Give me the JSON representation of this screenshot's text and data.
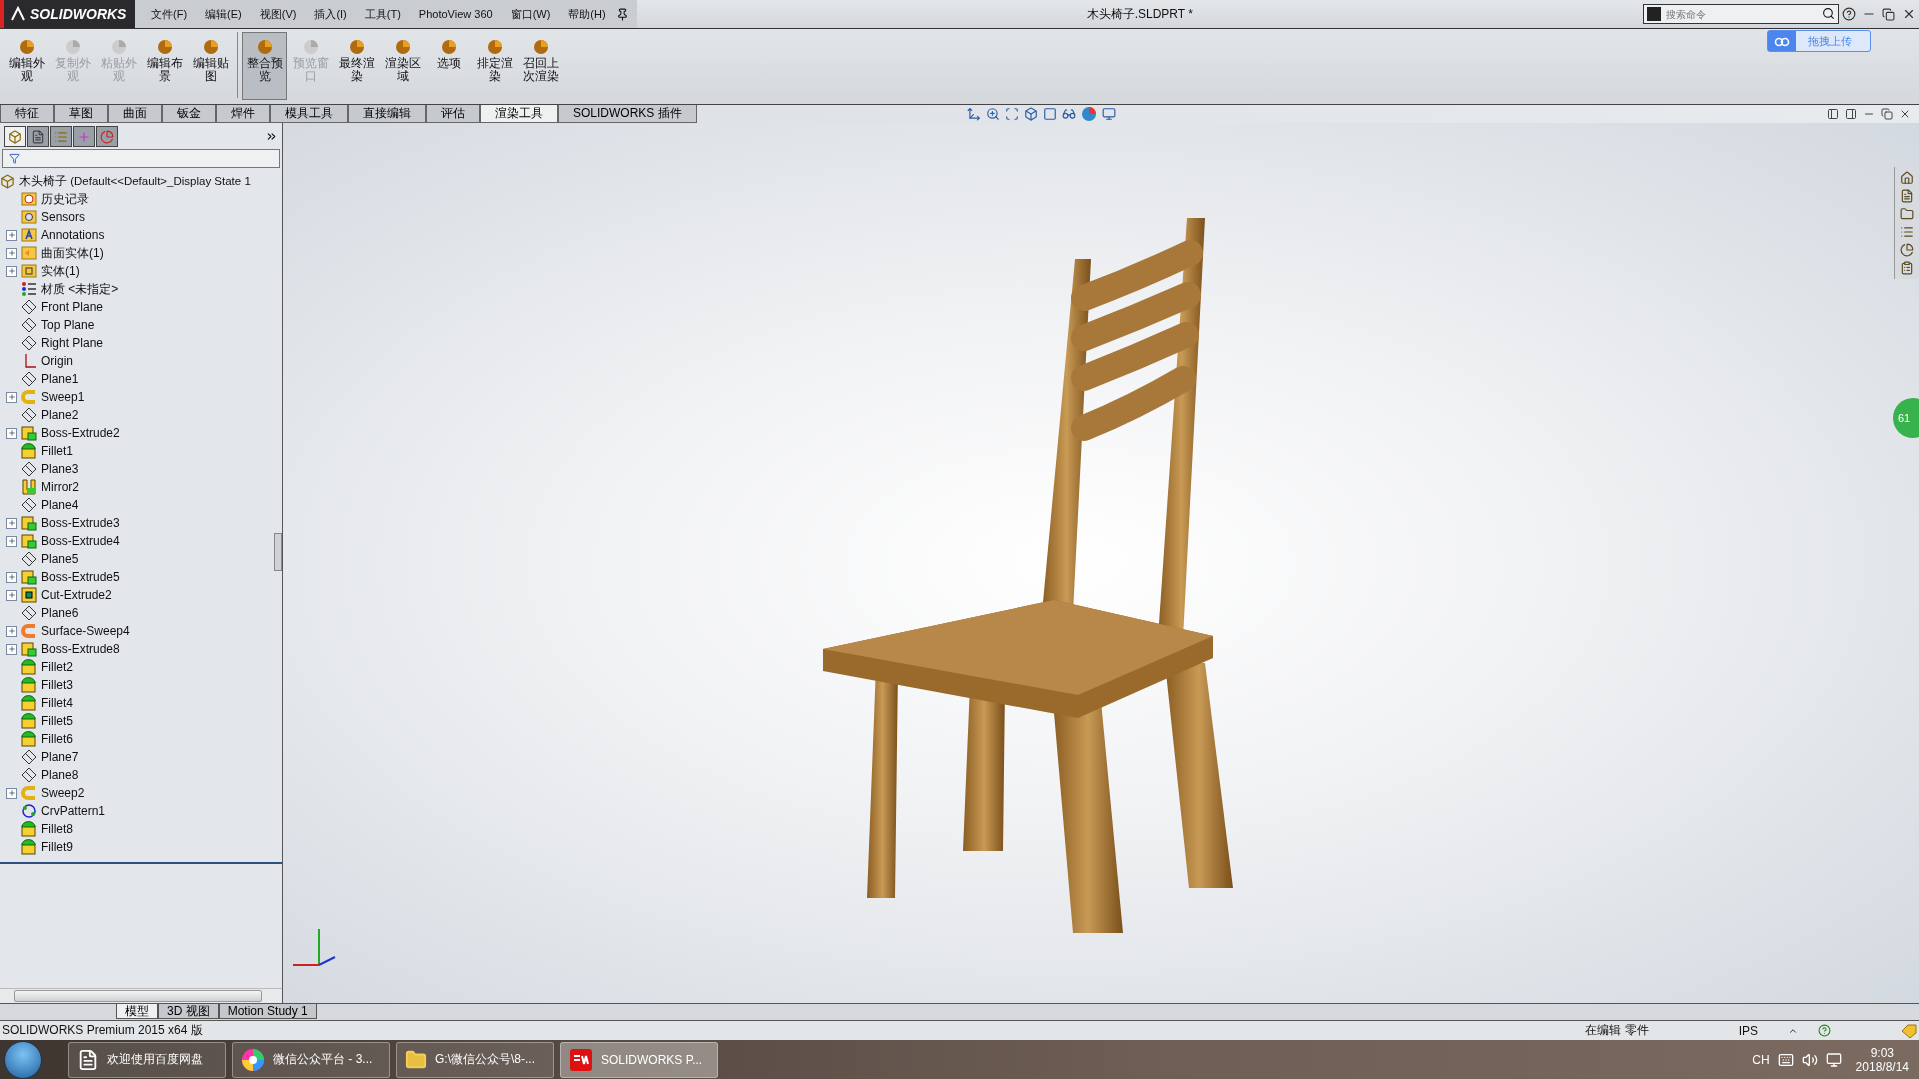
{
  "title_bar": {
    "logo": "SOLIDWORKS",
    "menus": [
      "文件(F)",
      "编辑(E)",
      "视图(V)",
      "插入(I)",
      "工具(T)",
      "PhotoView 360",
      "窗口(W)",
      "帮助(H)"
    ],
    "document_title": "木头椅子.SLDPRT *",
    "search": {
      "placeholder": "搜索命令"
    },
    "upload_button": "拖拽上传"
  },
  "ribbon": [
    {
      "label": "编辑外观",
      "disabled": false,
      "selected": false
    },
    {
      "label": "复制外观",
      "disabled": true,
      "selected": false
    },
    {
      "label": "粘贴外观",
      "disabled": true,
      "selected": false
    },
    {
      "label": "编辑布景",
      "disabled": false,
      "selected": false
    },
    {
      "label": "编辑贴图",
      "disabled": false,
      "selected": false
    },
    {
      "label": "整合预览",
      "disabled": false,
      "selected": true
    },
    {
      "label": "预览窗口",
      "disabled": true,
      "selected": false
    },
    {
      "label": "最终渲染",
      "disabled": false,
      "selected": false
    },
    {
      "label": "渲染区域",
      "disabled": false,
      "selected": false
    },
    {
      "label": "选项",
      "disabled": false,
      "selected": false
    },
    {
      "label": "排定渲染",
      "disabled": false,
      "selected": false
    },
    {
      "label": "召回上次渲染",
      "disabled": false,
      "selected": false
    }
  ],
  "command_tabs": [
    {
      "label": "特征",
      "selected": false
    },
    {
      "label": "草图",
      "selected": false
    },
    {
      "label": "曲面",
      "selected": false
    },
    {
      "label": "钣金",
      "selected": false
    },
    {
      "label": "焊件",
      "selected": false
    },
    {
      "label": "模具工具",
      "selected": false
    },
    {
      "label": "直接编辑",
      "selected": false
    },
    {
      "label": "评估",
      "selected": false
    },
    {
      "label": "渲染工具",
      "selected": true
    },
    {
      "label": "SOLIDWORKS 插件",
      "selected": false
    }
  ],
  "feature_tree": {
    "panel_tabs": [
      {
        "kind": "tree",
        "selected": true
      },
      {
        "kind": "property",
        "selected": false
      },
      {
        "kind": "config",
        "selected": false
      },
      {
        "kind": "target",
        "selected": false
      },
      {
        "kind": "display",
        "selected": false
      }
    ],
    "root": "木头椅子  (Default<<Default>_Display State 1",
    "items": [
      {
        "label": "历史记录",
        "kind": "history"
      },
      {
        "label": "Sensors",
        "kind": "sensor"
      },
      {
        "label": "Annotations",
        "kind": "annotation",
        "expanded": false
      },
      {
        "label": "曲面实体(1)",
        "kind": "surface-folder",
        "expanded": false
      },
      {
        "label": "实体(1)",
        "kind": "solid-folder",
        "expanded": false
      },
      {
        "label": "材质 <未指定>",
        "kind": "material"
      },
      {
        "label": "Front Plane",
        "kind": "plane"
      },
      {
        "label": "Top Plane",
        "kind": "plane"
      },
      {
        "label": "Right Plane",
        "kind": "plane"
      },
      {
        "label": "Origin",
        "kind": "origin"
      },
      {
        "label": "Plane1",
        "kind": "plane"
      },
      {
        "label": "Sweep1",
        "kind": "sweep",
        "expanded": false
      },
      {
        "label": "Plane2",
        "kind": "plane"
      },
      {
        "label": "Boss-Extrude2",
        "kind": "extrude",
        "expanded": false
      },
      {
        "label": "Fillet1",
        "kind": "fillet"
      },
      {
        "label": "Plane3",
        "kind": "plane"
      },
      {
        "label": "Mirror2",
        "kind": "mirror"
      },
      {
        "label": "Plane4",
        "kind": "plane"
      },
      {
        "label": "Boss-Extrude3",
        "kind": "extrude",
        "expanded": false
      },
      {
        "label": "Boss-Extrude4",
        "kind": "extrude",
        "expanded": false
      },
      {
        "label": "Plane5",
        "kind": "plane"
      },
      {
        "label": "Boss-Extrude5",
        "kind": "extrude",
        "expanded": false
      },
      {
        "label": "Cut-Extrude2",
        "kind": "cut",
        "expanded": false
      },
      {
        "label": "Plane6",
        "kind": "plane"
      },
      {
        "label": "Surface-Sweep4",
        "kind": "surface-sweep",
        "expanded": false
      },
      {
        "label": "Boss-Extrude8",
        "kind": "extrude",
        "expanded": false
      },
      {
        "label": "Fillet2",
        "kind": "fillet"
      },
      {
        "label": "Fillet3",
        "kind": "fillet"
      },
      {
        "label": "Fillet4",
        "kind": "fillet"
      },
      {
        "label": "Fillet5",
        "kind": "fillet"
      },
      {
        "label": "Fillet6",
        "kind": "fillet"
      },
      {
        "label": "Plane7",
        "kind": "plane"
      },
      {
        "label": "Plane8",
        "kind": "plane"
      },
      {
        "label": "Sweep2",
        "kind": "sweep",
        "expanded": false
      },
      {
        "label": "CrvPattern1",
        "kind": "pattern"
      },
      {
        "label": "Fillet8",
        "kind": "fillet"
      },
      {
        "label": "Fillet9",
        "kind": "fillet"
      }
    ]
  },
  "viewport": {
    "side_badge": "61"
  },
  "bottom_tabs": [
    {
      "label": "模型",
      "selected": true
    },
    {
      "label": "3D 视图",
      "selected": false
    },
    {
      "label": "Motion Study 1",
      "selected": false
    }
  ],
  "status_bar": {
    "product": "SOLIDWORKS Premium 2015 x64 版",
    "mode": "在编辑 零件",
    "units": "IPS"
  },
  "taskbar": {
    "tasks": [
      {
        "label": "欢迎使用百度网盘",
        "kind": "document",
        "selected": false
      },
      {
        "label": "微信公众平台 - 3...",
        "kind": "browser",
        "selected": false
      },
      {
        "label": "G:\\微信公众号\\8-...",
        "kind": "folder",
        "selected": false
      },
      {
        "label": "SOLIDWORKS P...",
        "kind": "solidworks",
        "selected": true
      }
    ],
    "language": "CH",
    "time": "9:03",
    "date": "2018/8/14"
  }
}
